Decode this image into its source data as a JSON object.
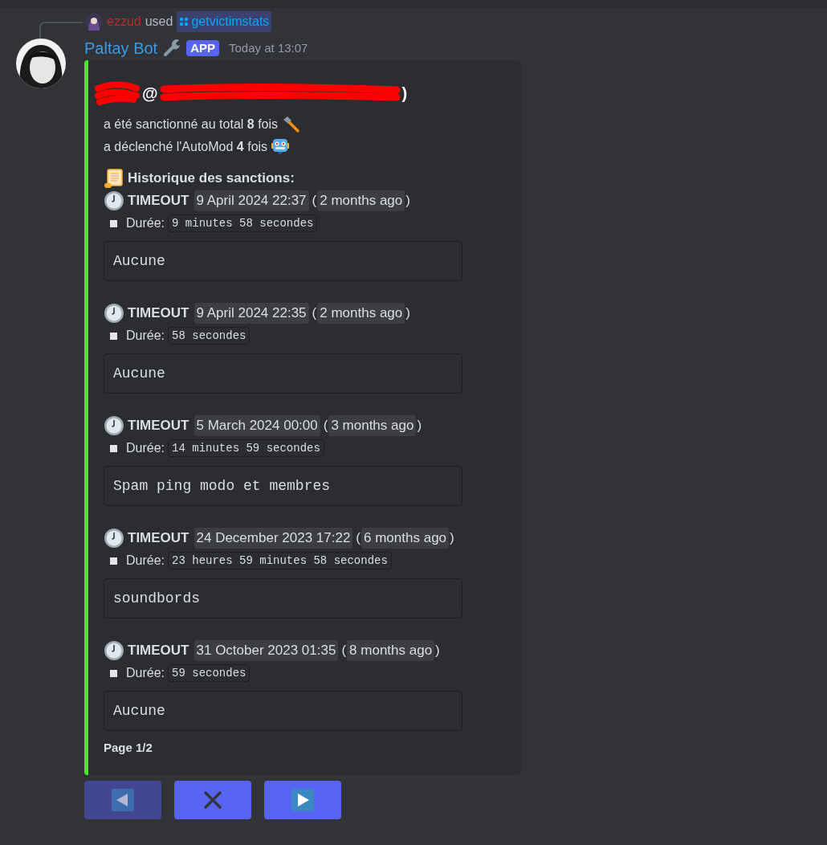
{
  "reply": {
    "user": "ezzud",
    "verb": "used",
    "command": "getvictimstats"
  },
  "message": {
    "author": "Paltay Bot",
    "badge": "APP",
    "timestamp": "Today at 13:07"
  },
  "embed": {
    "title_fragments": [
      "@",
      ")"
    ],
    "summary": [
      {
        "text": "a été sanctionné au total **8** fois",
        "kind": "hammer"
      },
      {
        "text": "a déclenché l'AutoMod **4** fois",
        "kind": "robot"
      }
    ],
    "history_title": "Historique des sanctions:",
    "sanctions": [
      {
        "type": "TIMEOUT",
        "date": "9 April 2024 22:37",
        "open": "(",
        "relative": "2 months ago",
        "close": ")",
        "duration_label": "Durée:",
        "duration": "9 minutes 58 secondes",
        "reason": "Aucune"
      },
      {
        "type": "TIMEOUT",
        "date": "9 April 2024 22:35",
        "open": "(",
        "relative": "2 months ago",
        "close": ")",
        "duration_label": "Durée:",
        "duration": "58 secondes",
        "reason": "Aucune"
      },
      {
        "type": "TIMEOUT",
        "date": "5 March 2024 00:00",
        "open": "(",
        "relative": "3 months ago",
        "close": ")",
        "duration_label": "Durée:",
        "duration": "14 minutes 59 secondes",
        "reason": "Spam ping modo et membres"
      },
      {
        "type": "TIMEOUT",
        "date": "24 December 2023 17:22",
        "open": "(",
        "relative": "6 months ago",
        "close": ")",
        "duration_label": "Durée:",
        "duration": "23 heures 59 minutes 58 secondes",
        "reason": "soundbords"
      },
      {
        "type": "TIMEOUT",
        "date": "31 October 2023 01:35",
        "open": "(",
        "relative": "8 months ago",
        "close": ")",
        "duration_label": "Durée:",
        "duration": "59 secondes",
        "reason": "Aucune"
      }
    ],
    "footer": "Page 1/2"
  },
  "buttons": [
    {
      "kind": "previous",
      "disabled": true
    },
    {
      "kind": "close",
      "disabled": false
    },
    {
      "kind": "next",
      "disabled": false
    }
  ]
}
